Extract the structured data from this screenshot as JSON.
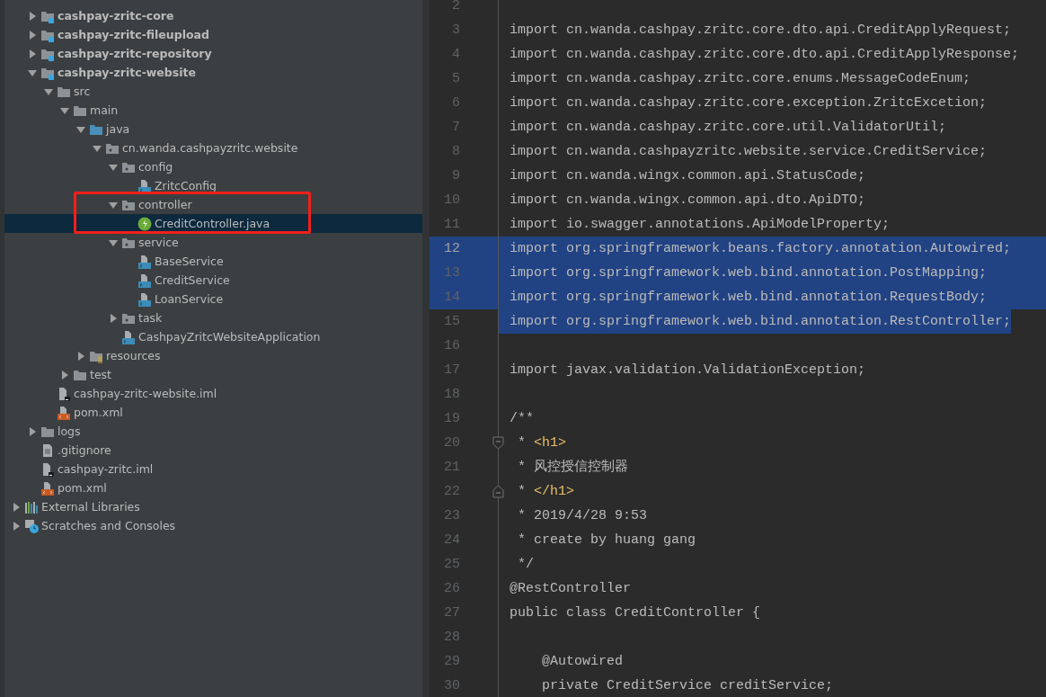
{
  "project_tree": {
    "items": [
      {
        "label": "cashpay-zritc-core",
        "kind": "module",
        "expanded": false,
        "selected": false
      },
      {
        "label": "cashpay-zritc-fileupload",
        "kind": "module",
        "expanded": false,
        "selected": false
      },
      {
        "label": "cashpay-zritc-repository",
        "kind": "module",
        "expanded": false,
        "selected": false
      },
      {
        "label": "cashpay-zritc-website",
        "kind": "module",
        "expanded": true,
        "selected": false,
        "children": [
          {
            "label": "src",
            "kind": "folder",
            "expanded": true,
            "selected": false,
            "children": [
              {
                "label": "main",
                "kind": "folder",
                "expanded": true,
                "selected": false,
                "children": [
                  {
                    "label": "java",
                    "kind": "source-folder",
                    "expanded": true,
                    "selected": false,
                    "children": [
                      {
                        "label": "cn.wanda.cashpayzritc.website",
                        "kind": "package",
                        "expanded": true,
                        "selected": false,
                        "children": [
                          {
                            "label": "config",
                            "kind": "package",
                            "expanded": true,
                            "selected": false,
                            "children": [
                              {
                                "label": "ZritcConfig",
                                "kind": "class",
                                "selected": false
                              }
                            ]
                          },
                          {
                            "label": "controller",
                            "kind": "package",
                            "expanded": true,
                            "selected": false,
                            "children": [
                              {
                                "label": "CreditController.java",
                                "kind": "spring-class",
                                "selected": true
                              }
                            ]
                          },
                          {
                            "label": "service",
                            "kind": "package",
                            "expanded": true,
                            "selected": false,
                            "children": [
                              {
                                "label": "BaseService",
                                "kind": "class",
                                "selected": false
                              },
                              {
                                "label": "CreditService",
                                "kind": "class",
                                "selected": false
                              },
                              {
                                "label": "LoanService",
                                "kind": "class",
                                "selected": false
                              }
                            ]
                          },
                          {
                            "label": "task",
                            "kind": "package",
                            "expanded": false,
                            "selected": false
                          },
                          {
                            "label": "CashpayZritcWebsiteApplication",
                            "kind": "class",
                            "selected": false
                          }
                        ]
                      }
                    ]
                  },
                  {
                    "label": "resources",
                    "kind": "resources",
                    "expanded": false,
                    "selected": false
                  }
                ]
              },
              {
                "label": "test",
                "kind": "folder",
                "expanded": false,
                "selected": false
              }
            ]
          },
          {
            "label": "cashpay-zritc-website.iml",
            "kind": "iml",
            "selected": false
          },
          {
            "label": "pom.xml",
            "kind": "xml",
            "selected": false
          }
        ]
      },
      {
        "label": "logs",
        "kind": "folder",
        "expanded": false,
        "selected": false
      },
      {
        "label": ".gitignore",
        "kind": "text",
        "selected": false
      },
      {
        "label": "cashpay-zritc.iml",
        "kind": "iml",
        "selected": false
      },
      {
        "label": "pom.xml",
        "kind": "xml",
        "selected": false
      }
    ],
    "root_items": [
      {
        "label": "External Libraries",
        "kind": "libraries",
        "expanded": false,
        "selected": false
      },
      {
        "label": "Scratches and Consoles",
        "kind": "scratches",
        "expanded": false,
        "selected": false
      }
    ],
    "red_box": true
  },
  "editor": {
    "lines": [
      {
        "number": "2",
        "selected": false
      },
      {
        "number": "3",
        "text": "import cn.wanda.cashpay.zritc.core.dto.api.CreditApplyRequest;",
        "selected": false
      },
      {
        "number": "4",
        "text": "import cn.wanda.cashpay.zritc.core.dto.api.CreditApplyResponse;",
        "selected": false
      },
      {
        "number": "5",
        "text": "import cn.wanda.cashpay.zritc.core.enums.MessageCodeEnum;",
        "selected": false
      },
      {
        "number": "6",
        "text": "import cn.wanda.cashpay.zritc.core.exception.ZritcExcetion;",
        "selected": false
      },
      {
        "number": "7",
        "text": "import cn.wanda.cashpay.zritc.core.util.ValidatorUtil;",
        "selected": false
      },
      {
        "number": "8",
        "text": "import cn.wanda.cashpayzritc.website.service.CreditService;",
        "selected": false
      },
      {
        "number": "9",
        "text": "import cn.wanda.wingx.common.api.StatusCode;",
        "selected": false
      },
      {
        "number": "10",
        "text": "import cn.wanda.wingx.common.api.dto.ApiDTO;",
        "selected": false
      },
      {
        "number": "11",
        "text": "import io.swagger.annotations.ApiModelProperty;",
        "selected": false
      },
      {
        "number": "12",
        "text": "import org.springframework.beans.factory.annotation.Autowired;",
        "selected": true,
        "current": true
      },
      {
        "number": "13",
        "text": "import org.springframework.web.bind.annotation.PostMapping;",
        "selected": true
      },
      {
        "number": "14",
        "text": "import org.springframework.web.bind.annotation.RequestBody;",
        "selected": true
      },
      {
        "number": "15",
        "text": "import org.springframework.web.bind.annotation.RestController;",
        "selected": true
      },
      {
        "number": "16",
        "selected": false
      },
      {
        "number": "17",
        "text": "import javax.validation.ValidationException;",
        "selected": false
      },
      {
        "number": "18",
        "selected": false
      },
      {
        "number": "19",
        "text": "/**",
        "selected": false
      },
      {
        "number": "20",
        "segments": [
          {
            "kind": "comment",
            "text": " * "
          },
          {
            "kind": "tag",
            "text": "<h1>"
          }
        ],
        "fold_start": true,
        "selected": false
      },
      {
        "number": "21",
        "text": " * 风控授信控制器",
        "selected": false
      },
      {
        "number": "22",
        "segments": [
          {
            "kind": "comment",
            "text": " * "
          },
          {
            "kind": "tag",
            "text": "</h1>"
          }
        ],
        "fold_end": true,
        "selected": false
      },
      {
        "number": "23",
        "text": " * 2019/4/28 9:53",
        "selected": false
      },
      {
        "number": "24",
        "text": " * create by huang gang",
        "selected": false
      },
      {
        "number": "25",
        "text": " */",
        "selected": false
      },
      {
        "number": "26",
        "text": "@RestController",
        "selected": false
      },
      {
        "number": "27",
        "text": "public class CreditController {",
        "selected": false
      },
      {
        "number": "28",
        "selected": false
      },
      {
        "number": "29",
        "text": "    @Autowired",
        "selected": false
      },
      {
        "number": "30",
        "text": "    private CreditService creditService;",
        "selected": false
      }
    ]
  }
}
